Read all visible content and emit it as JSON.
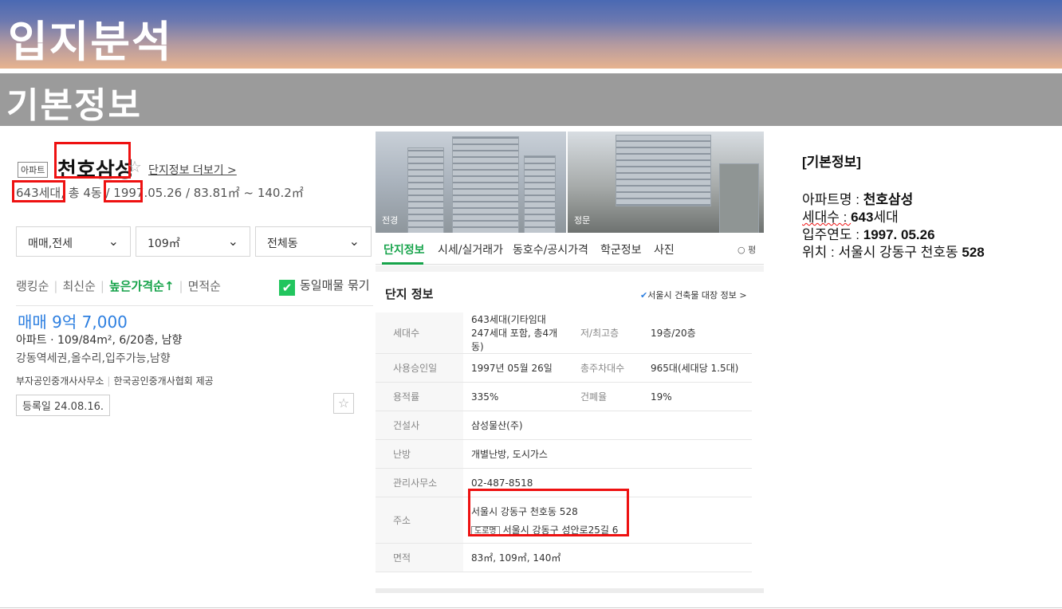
{
  "banner": {
    "title": "입지분석",
    "subtitle": "기본정보"
  },
  "listing": {
    "type_tag": "아파트",
    "name": "천호삼성",
    "more_link": "단지정보 더보기 >",
    "households": "643세대",
    "buildings": ", 총 4동 / ",
    "year": "1997.",
    "date_rest": "05.26 / 83.81㎡ ~ 140.2㎡",
    "filters": [
      "매매,전세",
      "109㎡",
      "전체동"
    ],
    "sort_options": [
      "랭킹순",
      "최신순",
      "높은가격순↑",
      "면적순"
    ],
    "same_listing_toggle": "동일매물 묶기",
    "price": "매매 9억 7,000",
    "detail_line": "아파트 · 109/84m², 6/20층, 남향",
    "feature_line": "강동역세권,올수리,입주가능,남향",
    "agent_name": "부자공인중개사사무소",
    "agent_source": "한국공인중개사협회 제공",
    "reg_date": "등록일 24.08.16."
  },
  "complex": {
    "photo_labels": [
      "전경",
      "정문"
    ],
    "tabs": [
      "단지정보",
      "시세/실거래가",
      "동호수/공시가격",
      "학군정보",
      "사진"
    ],
    "tab_more": "○ 평",
    "section_title": "단지 정보",
    "registry_link": "서울시 건축물 대장 정보 >",
    "rows": [
      {
        "label": "세대수",
        "value": "643세대(기타임대 247세대 포함, 총4개동)",
        "label2": "저/최고층",
        "value2": "19층/20층"
      },
      {
        "label": "사용승인일",
        "value": "1997년 05월 26일",
        "label2": "총주차대수",
        "value2": "965대(세대당 1.5대)"
      },
      {
        "label": "용적률",
        "value": "335%",
        "label2": "건폐율",
        "value2": "19%"
      },
      {
        "label": "건설사",
        "value": "삼성물산(주)"
      },
      {
        "label": "난방",
        "value": "개별난방, 도시가스"
      },
      {
        "label": "관리사무소",
        "value": "02-487-8518"
      },
      {
        "label": "주소",
        "value": "서울시 강동구 천호동 528",
        "road_tag": "도로명",
        "road_value": "서울시 강동구 성안로25길 6"
      },
      {
        "label": "면적",
        "value": "83㎡, 109㎡, 140㎡"
      }
    ]
  },
  "summary": {
    "heading": "[기본정보]",
    "rows": [
      {
        "label": "아파트명 : ",
        "value": "천호삼성"
      },
      {
        "label": "세대수 : ",
        "value": "643",
        "suffix": "세대"
      },
      {
        "label": "입주연도 : ",
        "value": "1997. 05.26"
      },
      {
        "label": "위치 : ",
        "value": "서울시 강동구 천호동 ",
        "num": "528"
      }
    ]
  },
  "colors": {
    "accent_green": "#16a34a",
    "price_blue": "#2d7fe0",
    "highlight_red": "#ee1111"
  }
}
